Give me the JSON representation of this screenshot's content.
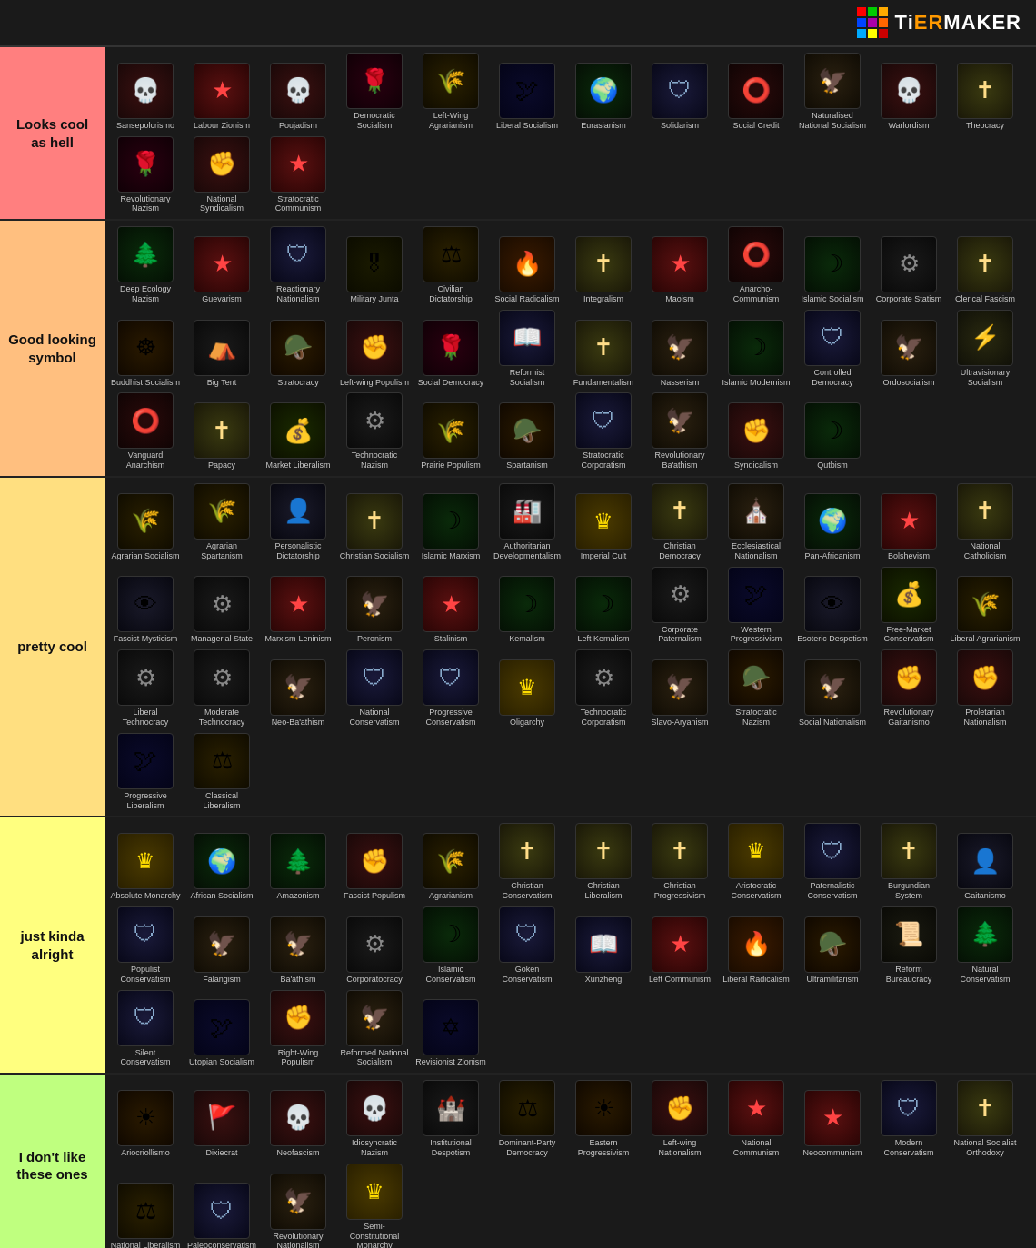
{
  "header": {
    "logo_text_ti": "Ti",
    "logo_text_er": "ER",
    "logo_text_maker": "MAKER"
  },
  "tiers": [
    {
      "id": "s",
      "label": "Looks cool\nas hell",
      "color": "#ff7f7f",
      "items": [
        {
          "name": "Sansepolcrismo",
          "icon": "skull",
          "color": "gray"
        },
        {
          "name": "Labour Zionism",
          "icon": "star",
          "color": "blue"
        },
        {
          "name": "Poujadism",
          "icon": "skull",
          "color": "gray"
        },
        {
          "name": "Democratic Socialism",
          "icon": "rose",
          "color": "red"
        },
        {
          "name": "Left-Wing Agrarianism",
          "icon": "wheat",
          "color": "green"
        },
        {
          "name": "Liberal Socialism",
          "icon": "dove",
          "color": "blue"
        },
        {
          "name": "Eurasianism",
          "icon": "globe",
          "color": "gold"
        },
        {
          "name": "Solidarism",
          "icon": "shield",
          "color": "gray"
        },
        {
          "name": "Social Credit",
          "icon": "circle",
          "color": "red"
        },
        {
          "name": "Naturalised National Socialism",
          "icon": "eagle",
          "color": "gray"
        },
        {
          "name": "Warlordism",
          "icon": "skull",
          "color": "gray"
        },
        {
          "name": "Theocracy",
          "icon": "cross",
          "color": "gold"
        },
        {
          "name": "Revolutionary Nazism",
          "icon": "rose",
          "color": "red"
        },
        {
          "name": "National Syndicalism",
          "icon": "fist",
          "color": "gray"
        },
        {
          "name": "Stratocratic Communism",
          "icon": "star",
          "color": "red"
        }
      ]
    },
    {
      "id": "a",
      "label": "Good looking\nsymbol",
      "color": "#ffbf7f",
      "items": [
        {
          "name": "Deep Ecology Nazism",
          "icon": "tree",
          "color": "green"
        },
        {
          "name": "Guevarism",
          "icon": "star",
          "color": "red"
        },
        {
          "name": "Reactionary Nationalism",
          "icon": "shield",
          "color": "gray"
        },
        {
          "name": "Military Junta",
          "icon": "military",
          "color": "gray"
        },
        {
          "name": "Civilian Dictatorship",
          "icon": "scales",
          "color": "gold"
        },
        {
          "name": "Social Radicalism",
          "icon": "fire",
          "color": "red"
        },
        {
          "name": "Integralism",
          "icon": "cross",
          "color": "green"
        },
        {
          "name": "Maoism",
          "icon": "star",
          "color": "red"
        },
        {
          "name": "Anarcho-Communism",
          "icon": "circle",
          "color": "red"
        },
        {
          "name": "Islamic Socialism",
          "icon": "moon",
          "color": "green"
        },
        {
          "name": "Corporate Statism",
          "icon": "gear",
          "color": "gray"
        },
        {
          "name": "Clerical Fascism",
          "icon": "cross",
          "color": "gold"
        },
        {
          "name": "Buddhist Socialism",
          "icon": "wheel",
          "color": "gold"
        },
        {
          "name": "Big Tent",
          "icon": "tent",
          "color": "gray"
        },
        {
          "name": "Stratocracy",
          "icon": "helm",
          "color": "gray"
        },
        {
          "name": "Left-wing Populism",
          "icon": "fist",
          "color": "red"
        },
        {
          "name": "Social Democracy",
          "icon": "rose",
          "color": "red"
        },
        {
          "name": "Reformist Socialism",
          "icon": "book",
          "color": "red"
        },
        {
          "name": "Fundamentalism",
          "icon": "cross",
          "color": "gold"
        },
        {
          "name": "Nasserism",
          "icon": "eagle",
          "color": "gold"
        },
        {
          "name": "Islamic Modernism",
          "icon": "moon",
          "color": "green"
        },
        {
          "name": "Controlled Democracy",
          "icon": "shield",
          "color": "blue"
        },
        {
          "name": "Ordosocialism",
          "icon": "eagle",
          "color": "red"
        },
        {
          "name": "Ultravisionary Socialism",
          "icon": "lightning",
          "color": "red"
        },
        {
          "name": "Vanguard Anarchism",
          "icon": "circle",
          "color": "gray"
        },
        {
          "name": "Papacy",
          "icon": "cross",
          "color": "gold"
        },
        {
          "name": "Market Liberalism",
          "icon": "money",
          "color": "green"
        },
        {
          "name": "Technocratic Nazism",
          "icon": "gear",
          "color": "gray"
        },
        {
          "name": "Prairie Populism",
          "icon": "wheat",
          "color": "gold"
        },
        {
          "name": "Spartanism",
          "icon": "helm",
          "color": "gray"
        },
        {
          "name": "Stratocratic Corporatism",
          "icon": "shield",
          "color": "gray"
        },
        {
          "name": "Revolutionary Ba'athism",
          "icon": "eagle",
          "color": "green"
        },
        {
          "name": "Syndicalism",
          "icon": "fist",
          "color": "red"
        },
        {
          "name": "Qutbism",
          "icon": "moon",
          "color": "green"
        }
      ]
    },
    {
      "id": "b",
      "label": "pretty cool",
      "color": "#ffdf80",
      "items": [
        {
          "name": "Agrarian Socialism",
          "icon": "wheat",
          "color": "green"
        },
        {
          "name": "Agrarian Spartanism",
          "icon": "wheat",
          "color": "gray"
        },
        {
          "name": "Personalistic Dictatorship",
          "icon": "person",
          "color": "gray"
        },
        {
          "name": "Christian Socialism",
          "icon": "cross",
          "color": "red"
        },
        {
          "name": "Islamic Marxism",
          "icon": "moon",
          "color": "green"
        },
        {
          "name": "Authoritarian Developmentalism",
          "icon": "factory",
          "color": "gray"
        },
        {
          "name": "Imperial Cult",
          "icon": "crown",
          "color": "gold"
        },
        {
          "name": "Christian Democracy",
          "icon": "cross",
          "color": "blue"
        },
        {
          "name": "Ecclesiastical Nationalism",
          "icon": "church",
          "color": "gold"
        },
        {
          "name": "Pan-Africanism",
          "icon": "globe",
          "color": "green"
        },
        {
          "name": "Bolshevism",
          "icon": "star",
          "color": "red"
        },
        {
          "name": "National Catholicism",
          "icon": "cross",
          "color": "gold"
        },
        {
          "name": "Fascist Mysticism",
          "icon": "eye",
          "color": "gray"
        },
        {
          "name": "Managerial State",
          "icon": "gear",
          "color": "gray"
        },
        {
          "name": "Marxism-Leninism",
          "icon": "star",
          "color": "red"
        },
        {
          "name": "Peronism",
          "icon": "eagle",
          "color": "blue"
        },
        {
          "name": "Stalinism",
          "icon": "star",
          "color": "red"
        },
        {
          "name": "Kemalism",
          "icon": "moon",
          "color": "gray"
        },
        {
          "name": "Left Kemalism",
          "icon": "moon",
          "color": "red"
        },
        {
          "name": "Corporate Paternalism",
          "icon": "gear",
          "color": "gray"
        },
        {
          "name": "Western Progressivism",
          "icon": "dove",
          "color": "blue"
        },
        {
          "name": "Esoteric Despotism",
          "icon": "eye",
          "color": "purple"
        },
        {
          "name": "Free-Market Conservatism",
          "icon": "money",
          "color": "green"
        },
        {
          "name": "Liberal Agrarianism",
          "icon": "wheat",
          "color": "green"
        },
        {
          "name": "Liberal Technocracy",
          "icon": "gear",
          "color": "blue"
        },
        {
          "name": "Moderate Technocracy",
          "icon": "gear",
          "color": "gray"
        },
        {
          "name": "Neo-Ba'athism",
          "icon": "eagle",
          "color": "green"
        },
        {
          "name": "National Conservatism",
          "icon": "shield",
          "color": "blue"
        },
        {
          "name": "Progressive Conservatism",
          "icon": "shield",
          "color": "green"
        },
        {
          "name": "Oligarchy",
          "icon": "crown",
          "color": "gold"
        },
        {
          "name": "Technocratic Corporatism",
          "icon": "gear",
          "color": "gray"
        },
        {
          "name": "Slavo-Aryanism",
          "icon": "eagle",
          "color": "gray"
        },
        {
          "name": "Stratocratic Nazism",
          "icon": "helm",
          "color": "gray"
        },
        {
          "name": "Social Nationalism",
          "icon": "eagle",
          "color": "red"
        },
        {
          "name": "Revolutionary Gaitanismo",
          "icon": "fist",
          "color": "red"
        },
        {
          "name": "Proletarian Nationalism",
          "icon": "fist",
          "color": "red"
        },
        {
          "name": "Progressive Liberalism",
          "icon": "dove",
          "color": "blue"
        },
        {
          "name": "Classical Liberalism",
          "icon": "scales",
          "color": "gold"
        }
      ]
    },
    {
      "id": "c",
      "label": "just kinda\nalright",
      "color": "#ffff7f",
      "items": [
        {
          "name": "Absolute Monarchy",
          "icon": "crown",
          "color": "gold"
        },
        {
          "name": "African Socialism",
          "icon": "globe",
          "color": "green"
        },
        {
          "name": "Amazonism",
          "icon": "tree",
          "color": "green"
        },
        {
          "name": "Fascist Populism",
          "icon": "fist",
          "color": "gray"
        },
        {
          "name": "Agrarianism",
          "icon": "wheat",
          "color": "green"
        },
        {
          "name": "Christian Conservatism",
          "icon": "cross",
          "color": "blue"
        },
        {
          "name": "Christian Liberalism",
          "icon": "cross",
          "color": "gold"
        },
        {
          "name": "Christian Progressivism",
          "icon": "cross",
          "color": "green"
        },
        {
          "name": "Aristocratic Conservatism",
          "icon": "crown",
          "color": "gold"
        },
        {
          "name": "Paternalistic Conservatism",
          "icon": "shield",
          "color": "gray"
        },
        {
          "name": "Burgundian System",
          "icon": "cross",
          "color": "gold"
        },
        {
          "name": "Gaitanismo",
          "icon": "person",
          "color": "gray"
        },
        {
          "name": "Populist Conservatism",
          "icon": "shield",
          "color": "blue"
        },
        {
          "name": "Falangism",
          "icon": "eagle",
          "color": "gray"
        },
        {
          "name": "Ba'athism",
          "icon": "eagle",
          "color": "green"
        },
        {
          "name": "Corporatocracy",
          "icon": "gear",
          "color": "gray"
        },
        {
          "name": "Islamic Conservatism",
          "icon": "moon",
          "color": "green"
        },
        {
          "name": "Goken Conservatism",
          "icon": "shield",
          "color": "gray"
        },
        {
          "name": "Xunzheng",
          "icon": "book",
          "color": "gold"
        },
        {
          "name": "Left Communism",
          "icon": "star",
          "color": "red"
        },
        {
          "name": "Liberal Radicalism",
          "icon": "fire",
          "color": "orange"
        },
        {
          "name": "Ultramilitarism",
          "icon": "helm",
          "color": "gray"
        },
        {
          "name": "Reform Bureaucracy",
          "icon": "note",
          "color": "gray"
        },
        {
          "name": "Natural Conservatism",
          "icon": "tree",
          "color": "green"
        },
        {
          "name": "Silent Conservatism",
          "icon": "shield",
          "color": "gray"
        },
        {
          "name": "Utopian Socialism",
          "icon": "dove",
          "color": "red"
        },
        {
          "name": "Right-Wing Populism",
          "icon": "fist",
          "color": "gray"
        },
        {
          "name": "Reformed National Socialism",
          "icon": "eagle",
          "color": "gray"
        },
        {
          "name": "Revisionist Zionism",
          "icon": "hexagram",
          "color": "blue"
        }
      ]
    },
    {
      "id": "d",
      "label": "I don't like\nthese ones",
      "color": "#bfff7f",
      "items": [
        {
          "name": "Ariocriollismo",
          "icon": "sun",
          "color": "gold"
        },
        {
          "name": "Dixiecrat",
          "icon": "flag",
          "color": "gray"
        },
        {
          "name": "Neofascism",
          "icon": "skull",
          "color": "gray"
        },
        {
          "name": "Idiosyncratic Nazism",
          "icon": "skull",
          "color": "gray"
        },
        {
          "name": "Institutional Despotism",
          "icon": "castle",
          "color": "gray"
        },
        {
          "name": "Dominant-Party Democracy",
          "icon": "scales",
          "color": "blue"
        },
        {
          "name": "Eastern Progressivism",
          "icon": "sun",
          "color": "gold"
        },
        {
          "name": "Left-wing Nationalism",
          "icon": "fist",
          "color": "red"
        },
        {
          "name": "National Communism",
          "icon": "star",
          "color": "red"
        },
        {
          "name": "Neocommunism",
          "icon": "star",
          "color": "red"
        },
        {
          "name": "Modern Conservatism",
          "icon": "shield",
          "color": "blue"
        },
        {
          "name": "National Socialist Orthodoxy",
          "icon": "cross",
          "color": "red"
        },
        {
          "name": "National Liberalism",
          "icon": "scales",
          "color": "gold"
        },
        {
          "name": "Paleoconservatism",
          "icon": "shield",
          "color": "gray"
        },
        {
          "name": "Revolutionary Nationalism",
          "icon": "eagle",
          "color": "gray"
        },
        {
          "name": "Semi-Constitutional Monarchy",
          "icon": "crown",
          "color": "gold"
        }
      ]
    }
  ],
  "logo_colors": [
    "#ff0000",
    "#00cc00",
    "#ffaa00",
    "#0044ff",
    "#aa00aa",
    "#ff6600",
    "#00aaff",
    "#ffff00",
    "#cc0000"
  ]
}
